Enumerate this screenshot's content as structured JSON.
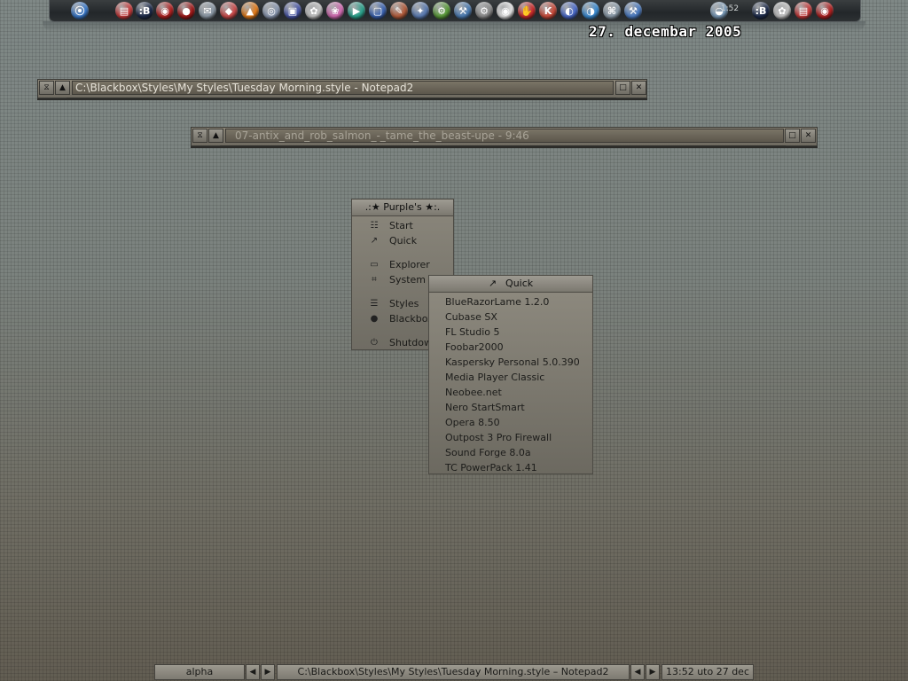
{
  "dock": {
    "clock": "1:52",
    "icons": [
      {
        "name": "smartdock-icon",
        "glyph": "⦿",
        "color": "#3a78c8"
      },
      {
        "name": "calendar-icon",
        "glyph": "▤",
        "color": "#c63a3a"
      },
      {
        "name": "blackbox-icon",
        "glyph": ":B",
        "color": "#1c2a4a"
      },
      {
        "name": "pokeball-icon",
        "glyph": "◉",
        "color": "#b02020"
      },
      {
        "name": "red-orb-icon",
        "glyph": "●",
        "color": "#a01818"
      },
      {
        "name": "mail-icon",
        "glyph": "✉",
        "color": "#8a97a4"
      },
      {
        "name": "diamond-icon",
        "glyph": "◆",
        "color": "#c84a4a"
      },
      {
        "name": "fl-studio-icon",
        "glyph": "▲",
        "color": "#e07a1a"
      },
      {
        "name": "disc-icon",
        "glyph": "◎",
        "color": "#8a98b0"
      },
      {
        "name": "monitor-icon",
        "glyph": "▣",
        "color": "#4a58a8"
      },
      {
        "name": "flower-icon",
        "glyph": "✿",
        "color": "#c0c0c0"
      },
      {
        "name": "palette-icon",
        "glyph": "❀",
        "color": "#d06ab0"
      },
      {
        "name": "play-icon",
        "glyph": "▶",
        "color": "#2aa08a"
      },
      {
        "name": "screen-icon",
        "glyph": "▢",
        "color": "#3a62b0"
      },
      {
        "name": "paint-icon",
        "glyph": "✎",
        "color": "#b05a3a"
      },
      {
        "name": "wand-icon",
        "glyph": "✦",
        "color": "#5a7ab0"
      },
      {
        "name": "gear-green-icon",
        "glyph": "⚙",
        "color": "#5a9a3a"
      },
      {
        "name": "tools-icon",
        "glyph": "⚒",
        "color": "#4a7ab0"
      },
      {
        "name": "settings-gear-icon",
        "glyph": "⚙",
        "color": "#8a8a8a"
      },
      {
        "name": "media-disc-icon",
        "glyph": "◉",
        "color": "#e0e0e0"
      },
      {
        "name": "hand-icon",
        "glyph": "✋",
        "color": "#c82a2a"
      },
      {
        "name": "kaspersky-icon",
        "glyph": "K",
        "color": "#c84a3a"
      },
      {
        "name": "globe-blue-icon",
        "glyph": "◐",
        "color": "#4a6ac8"
      },
      {
        "name": "globe-icon",
        "glyph": "◑",
        "color": "#3a8ad0"
      },
      {
        "name": "network-icon",
        "glyph": "⌘",
        "color": "#8a9aa8"
      },
      {
        "name": "tools-alt-icon",
        "glyph": "⚒",
        "color": "#4a7ac0"
      },
      {
        "name": "weather-orb-icon",
        "glyph": "◒",
        "color": "#7a9ab8"
      },
      {
        "name": "blackbox-alt-icon",
        "glyph": ":B",
        "color": "#1c2a4a"
      },
      {
        "name": "flower-alt-icon",
        "glyph": "✿",
        "color": "#c0c0c0"
      },
      {
        "name": "calendar-alt-icon",
        "glyph": "▤",
        "color": "#c63a3a"
      },
      {
        "name": "pokeball-alt-icon",
        "glyph": "◉",
        "color": "#b02020"
      }
    ]
  },
  "date": "27. decembar 2005",
  "windows": [
    {
      "title": "C:\\Blackbox\\Styles\\My Styles\\Tuesday Morning.style - Notepad2",
      "title_color": "#e6e2d8"
    },
    {
      "title": "07-antix_and_rob_salmon_-_tame_the_beast-upe  -  9:46",
      "title_color": "#a8a397"
    }
  ],
  "window_buttons": {
    "stick": "⧖",
    "shade": "▲",
    "maximize": "□",
    "close": "✕"
  },
  "main_menu": {
    "title": ".:★ Purple's ★:.",
    "items": [
      {
        "label": "Start",
        "icon": "☷"
      },
      {
        "label": "Quick",
        "icon": "↗"
      },
      {
        "label": "Explorer",
        "icon": "▭"
      },
      {
        "label": "System",
        "icon": "⌗"
      },
      {
        "label": "Styles",
        "icon": "☰"
      },
      {
        "label": "Blackbox",
        "icon": "●"
      },
      {
        "label": "Shutdown",
        "icon": "⏻"
      }
    ]
  },
  "quick_menu": {
    "title": "Quick",
    "icon": "↗",
    "items": [
      "BlueRazorLame 1.2.0",
      "Cubase SX",
      "FL Studio 5",
      "Foobar2000",
      "Kaspersky  Personal 5.0.390",
      "Media Player Classic",
      "Neobee.net",
      "Nero StartSmart",
      "Opera 8.50",
      "Outpost 3 Pro Firewall",
      "Sound Forge 8.0a",
      "TC PowerPack 1.41"
    ]
  },
  "taskbar": {
    "workspace": "alpha",
    "left_arrow": "◀",
    "right_arrow": "▶",
    "task": "C:\\Blackbox\\Styles\\My Styles\\Tuesday Morning.style – Notepad2",
    "clock": "13:52 uto 27 dec"
  }
}
